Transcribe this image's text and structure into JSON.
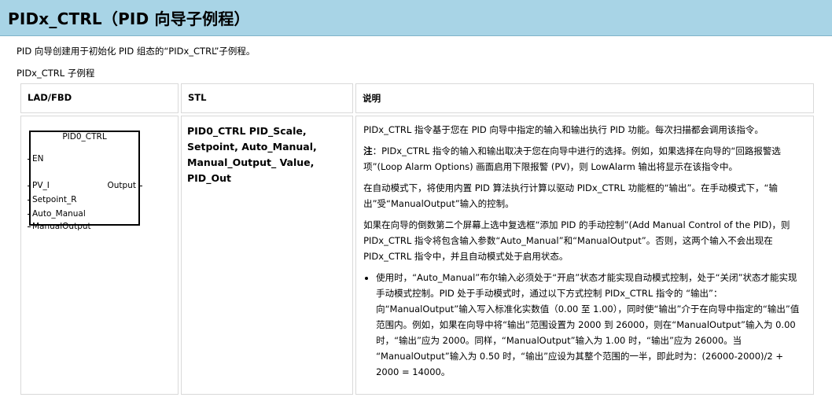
{
  "page": {
    "title": "PIDx_CTRL（PID 向导子例程）",
    "intro": "PID 向导创建用于初始化 PID 组态的“PIDx_CTRL”子例程。",
    "subheading": "PIDx_CTRL 子例程"
  },
  "table": {
    "headers": [
      "LAD/FBD",
      "STL",
      "说明"
    ],
    "lad": {
      "block_name": "PID0_CTRL",
      "inputs": [
        "EN",
        "PV_I",
        "Setpoint_R",
        "Auto_Manual",
        "ManualOutput"
      ],
      "output": "Output"
    },
    "stl_code": "PID0_CTRL PID_Scale, Setpoint, Auto_Manual, Manual_Output_ Value, PID_Out",
    "desc": {
      "p1": "PIDx_CTRL 指令基于您在 PID 向导中指定的输入和输出执行 PID 功能。每次扫描都会调用该指令。",
      "note_label": "注",
      "note_text": "：PIDx_CTRL 指令的输入和输出取决于您在向导中进行的选择。例如，如果选择在向导的“回路报警选项”(Loop Alarm Options) 画面启用下限报警 (PV)，则 LowAlarm 输出将显示在该指令中。",
      "p3": "在自动模式下，将使用内置 PID 算法执行计算以驱动 PIDx_CTRL 功能框的“输出”。在手动模式下，“输出”受“ManualOutput”输入的控制。",
      "p4": "如果在向导的倒数第二个屏幕上选中复选框“添加 PID 的手动控制”(Add Manual Control of the PID)，则 PIDx_CTRL 指令将包含输入参数“Auto_Manual”和“ManualOutput”。否则，这两个输入不会出现在 PIDx_CTRL 指令中，并且自动模式处于启用状态。",
      "bullet": "使用时，“Auto_Manual”布尔输入必须处于“开启”状态才能实现自动模式控制，处于“关闭”状态才能实现手动模式控制。PID 处于手动模式时，通过以下方式控制 PIDx_CTRL 指令的 “输出”：向“ManualOutput”输入写入标准化实数值（0.00 至 1.00），同时使“输出”介于在向导中指定的“输出”值范围内。例如，如果在向导中将“输出”范围设置为 2000 到 26000，则在“ManualOutput”输入为 0.00 时，“输出”应为 2000。同样，“ManualOutput”输入为 1.00 时，“输出”应为 26000。当 “ManualOutput”输入为 0.50 时，“输出”应设为其整个范围的一半，即此时为：(26000-2000)/2 + 2000 = 14000。"
    }
  }
}
